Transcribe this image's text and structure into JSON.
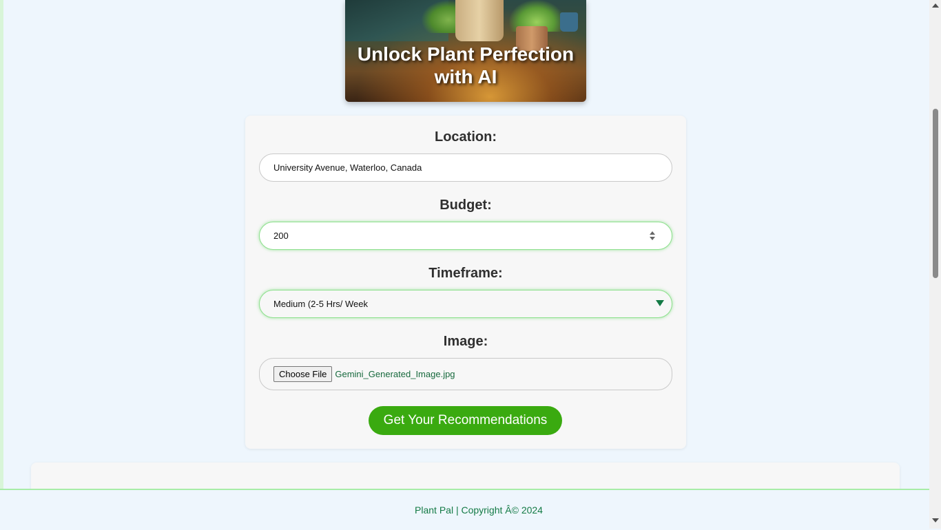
{
  "hero": {
    "title": "Unlock Plant Perfection with AI"
  },
  "form": {
    "location": {
      "label": "Location:",
      "value": "University Avenue, Waterloo, Canada"
    },
    "budget": {
      "label": "Budget:",
      "value": "200"
    },
    "timeframe": {
      "label": "Timeframe:",
      "selected": "Medium (2-5 Hrs/ Week"
    },
    "image": {
      "label": "Image:",
      "button_label": "Choose File",
      "filename": "Gemini_Generated_Image.jpg"
    },
    "submit_label": "Get Your Recommendations"
  },
  "footer": {
    "text": "Plant Pal | Copyright Â© 2024"
  },
  "colors": {
    "accent_green": "#3aaa10",
    "text_green": "#137a45",
    "focus_border": "#8ee08e",
    "page_background": "#eef6fd"
  }
}
